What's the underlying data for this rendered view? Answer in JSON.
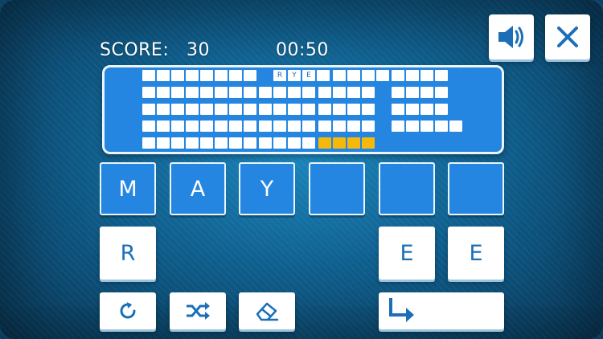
{
  "hud": {
    "score_label": "SCORE:",
    "score_value": "30",
    "timer": "00:50"
  },
  "icons": {
    "sound": "speaker-on-icon",
    "close": "close-x-icon",
    "rotate": "refresh-icon",
    "shuffle": "shuffle-icon",
    "erase": "eraser-icon",
    "submit": "enter-arrow-icon"
  },
  "colors": {
    "accent": "#2486e0",
    "tile_text": "#1c6fb7",
    "highlight": "#f5b90d"
  },
  "puzzle": {
    "revealed_word": [
      "R",
      "Y",
      "E"
    ]
  },
  "answer_slots": [
    "M",
    "A",
    "Y",
    "",
    "",
    ""
  ],
  "letter_keys": [
    "R",
    "E",
    "E"
  ]
}
